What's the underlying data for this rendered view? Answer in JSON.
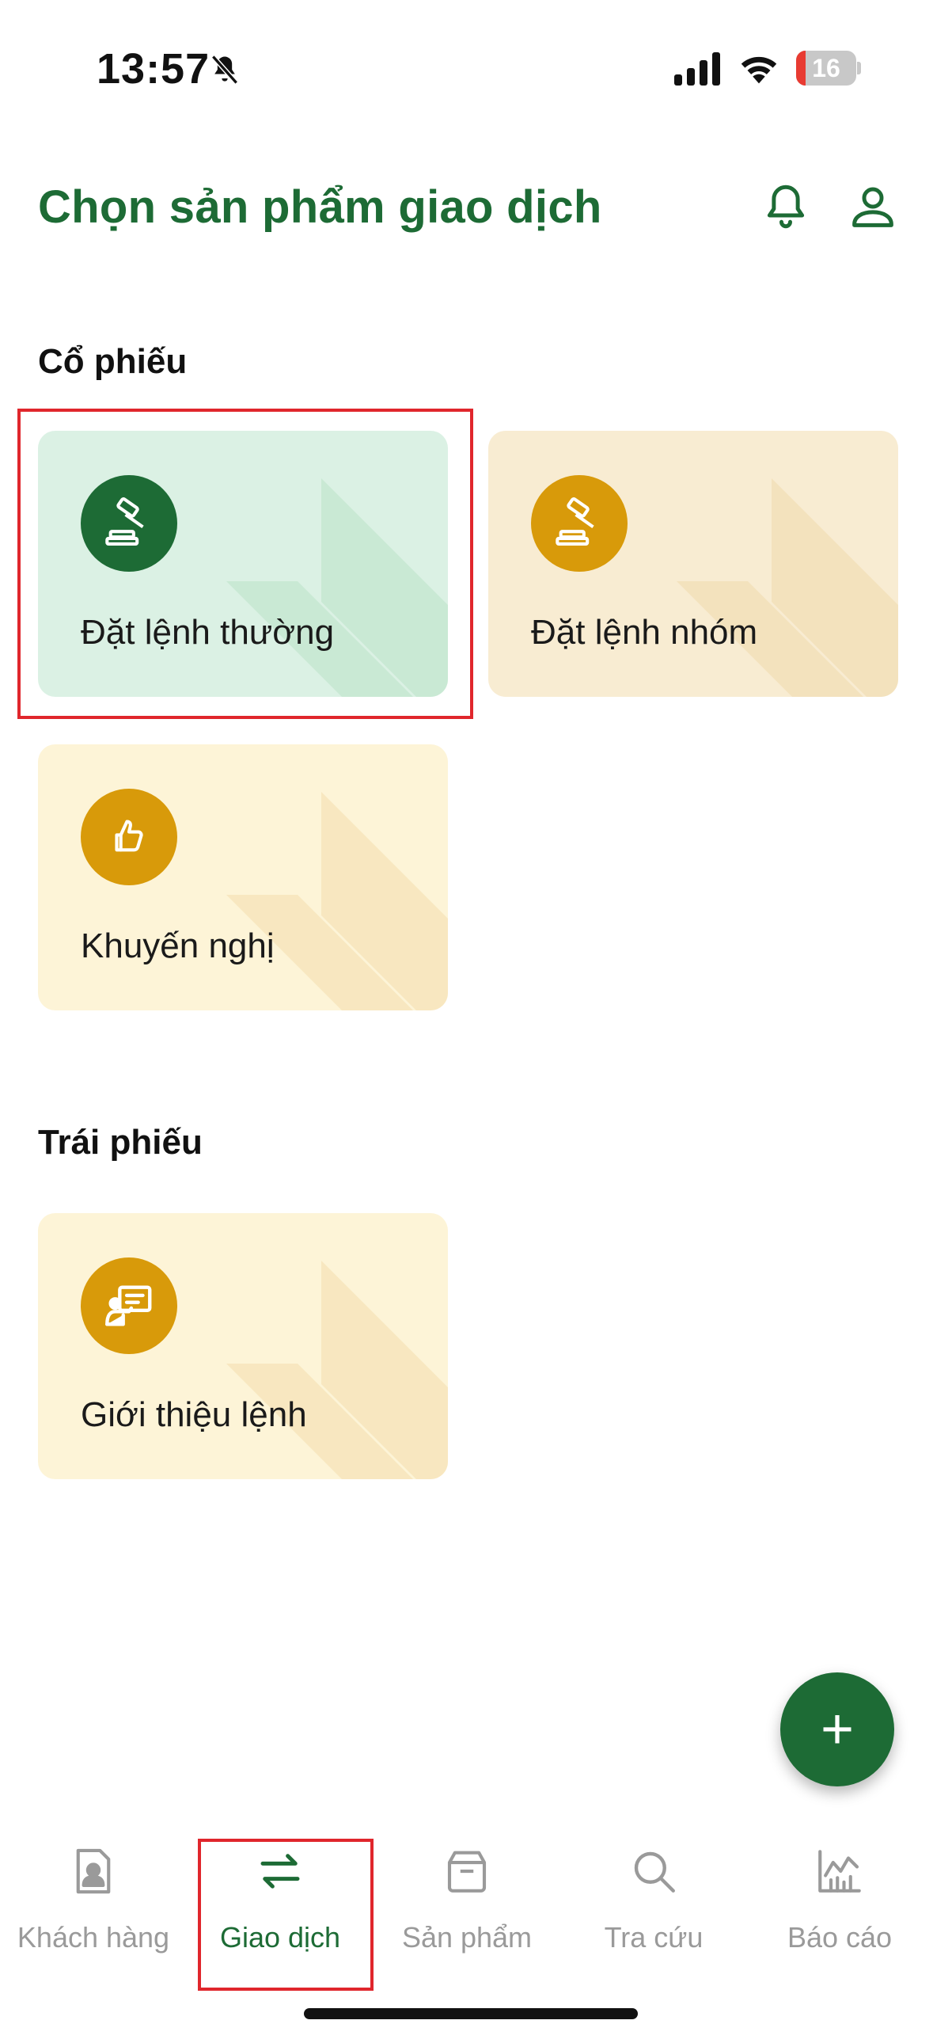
{
  "status_bar": {
    "time": "13:57",
    "battery": "16",
    "battery_level": 0.16,
    "icons": [
      "bell-muted-icon",
      "cellular-signal-icon",
      "wifi-icon",
      "battery-icon"
    ]
  },
  "header": {
    "title": "Chọn sản phẩm giao dịch",
    "icons": [
      "bell-icon",
      "user-icon"
    ]
  },
  "sections": {
    "stocks": {
      "title": "Cổ phiếu",
      "cards": [
        {
          "label": "Đặt lệnh thường",
          "icon": "gavel-icon",
          "selected": true
        },
        {
          "label": "Đặt lệnh nhóm",
          "icon": "gavel-icon"
        },
        {
          "label": "Khuyến nghị",
          "icon": "thumbs-up-icon"
        }
      ]
    },
    "bonds": {
      "title": "Trái phiếu",
      "cards": [
        {
          "label": "Giới thiệu lệnh",
          "icon": "presentation-icon"
        }
      ]
    }
  },
  "fab": {
    "label": "+",
    "icon": "plus-icon"
  },
  "bottom_nav": {
    "items": [
      {
        "label": "Khách hàng",
        "icon": "contact-card-icon"
      },
      {
        "label": "Giao dịch",
        "icon": "swap-arrows-icon",
        "active": true
      },
      {
        "label": "Sản phẩm",
        "icon": "box-icon"
      },
      {
        "label": "Tra cứu",
        "icon": "search-icon"
      },
      {
        "label": "Báo cáo",
        "icon": "chart-icon"
      }
    ]
  },
  "colors": {
    "brand_green": "#1d6b35",
    "gold": "#d89a0a",
    "card_green_bg": "#dbf1e4",
    "card_beige_bg": "#f8ecd2",
    "card_yellow_bg": "#fdf4d7",
    "highlight_red": "#e0262c",
    "nav_inactive": "#9a9a9a"
  }
}
